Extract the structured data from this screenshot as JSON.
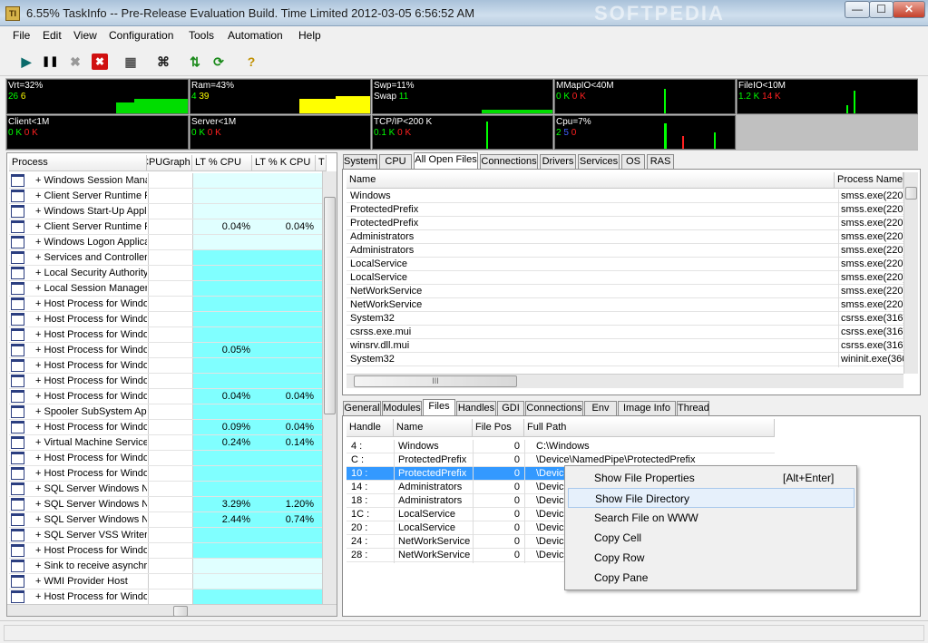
{
  "window": {
    "title": "6.55% TaskInfo -- Pre-Release Evaluation Build. Time Limited   2012-03-05 6:56:52 AM",
    "watermark": "SOFTPEDIA",
    "controls": {
      "minimize": "—",
      "maximize": "☐",
      "close": "✕"
    }
  },
  "menu": [
    "File",
    "Edit",
    "View",
    "Configuration",
    "Tools",
    "Automation",
    "Help"
  ],
  "toolbar": {
    "icons": [
      "play-icon",
      "pause-icon",
      "stop-icon",
      "kill-icon",
      "properties-icon",
      "binoculars-icon",
      "refresh-swap-icon",
      "refresh-icon",
      "help-icon"
    ],
    "glyphs": [
      "▶",
      "❚❚",
      "✖",
      "✖",
      "▦",
      "⌘",
      "⇅",
      "⟳",
      "?"
    ]
  },
  "graphs": {
    "vrt": {
      "label": "Vrt=32%",
      "v1": "26",
      "v2": "6"
    },
    "ram": {
      "label": "Ram=43%",
      "v1": "4",
      "v2": "39"
    },
    "swp": {
      "label": "Swp=11%",
      "v1": "Swap",
      "v2": "11"
    },
    "mmapio": {
      "label": "MMapIO<40M",
      "v1": "0 K",
      "v2": "0 K"
    },
    "fileio": {
      "label": "FileIO<10M",
      "v1": "1.2 K",
      "v2": "14 K"
    },
    "client": {
      "label": "Client<1M",
      "v1": "0 K",
      "v2": "0 K"
    },
    "server": {
      "label": "Server<1M",
      "v1": "0 K",
      "v2": "0 K"
    },
    "tcpip": {
      "label": "TCP/IP<200 K",
      "v1": "0.1 K",
      "v2": "0 K"
    },
    "cpu": {
      "label": "Cpu=7%",
      "v1": "2",
      "v2": "5",
      "v3": "0"
    }
  },
  "process_table": {
    "headers": [
      "Process",
      "CPUGraph",
      "LT % CPU",
      "LT % K CPU",
      "T"
    ],
    "rows": [
      {
        "name": "+ Windows Session Mana",
        "cpu": "",
        "kcpu": "",
        "hl": false
      },
      {
        "name": "+ Client Server Runtime P",
        "cpu": "",
        "kcpu": "",
        "hl": false
      },
      {
        "name": "+ Windows Start-Up Appli",
        "cpu": "",
        "kcpu": "",
        "hl": false
      },
      {
        "name": "+ Client Server Runtime P",
        "cpu": "0.04%",
        "kcpu": "0.04%",
        "hl": false
      },
      {
        "name": "+ Windows Logon Applica",
        "cpu": "",
        "kcpu": "",
        "hl": false
      },
      {
        "name": "+ Services and Controller",
        "cpu": "",
        "kcpu": "",
        "hl": true
      },
      {
        "name": "+ Local Security Authority",
        "cpu": "",
        "kcpu": "",
        "hl": true
      },
      {
        "name": "+ Local Session Manager",
        "cpu": "",
        "kcpu": "",
        "hl": true
      },
      {
        "name": "+ Host Process for Windo",
        "cpu": "",
        "kcpu": "",
        "hl": true
      },
      {
        "name": "+ Host Process for Windo",
        "cpu": "",
        "kcpu": "",
        "hl": true
      },
      {
        "name": "+ Host Process for Windo",
        "cpu": "",
        "kcpu": "",
        "hl": true
      },
      {
        "name": "+ Host Process for Windo",
        "cpu": "0.05%",
        "kcpu": "",
        "hl": true
      },
      {
        "name": "+ Host Process for Windo",
        "cpu": "",
        "kcpu": "",
        "hl": true
      },
      {
        "name": "+ Host Process for Windo",
        "cpu": "",
        "kcpu": "",
        "hl": true
      },
      {
        "name": "+ Host Process for Windo",
        "cpu": "0.04%",
        "kcpu": "0.04%",
        "hl": true
      },
      {
        "name": "+ Spooler SubSystem App",
        "cpu": "",
        "kcpu": "",
        "hl": true
      },
      {
        "name": "+ Host Process for Windo",
        "cpu": "0.09%",
        "kcpu": "0.04%",
        "hl": true
      },
      {
        "name": "+ Virtual Machine Service",
        "cpu": "0.24%",
        "kcpu": "0.14%",
        "hl": true
      },
      {
        "name": "+ Host Process for Windo",
        "cpu": "",
        "kcpu": "",
        "hl": true
      },
      {
        "name": "+ Host Process for Windo",
        "cpu": "",
        "kcpu": "",
        "hl": true
      },
      {
        "name": "+ SQL Server Windows N",
        "cpu": "",
        "kcpu": "",
        "hl": true
      },
      {
        "name": "+ SQL Server Windows N",
        "cpu": "3.29%",
        "kcpu": "1.20%",
        "hl": true
      },
      {
        "name": "+ SQL Server Windows N",
        "cpu": "2.44%",
        "kcpu": "0.74%",
        "hl": true
      },
      {
        "name": "+ SQL Server VSS Writer",
        "cpu": "",
        "kcpu": "",
        "hl": true
      },
      {
        "name": "+ Host Process for Windo",
        "cpu": "",
        "kcpu": "",
        "hl": true
      },
      {
        "name": "+ Sink to receive asynchr",
        "cpu": "",
        "kcpu": "",
        "hl": false
      },
      {
        "name": "+ WMI Provider Host",
        "cpu": "",
        "kcpu": "",
        "hl": false
      },
      {
        "name": "+ Host Process for Windo",
        "cpu": "",
        "kcpu": "",
        "hl": true
      }
    ]
  },
  "top_tabs": [
    "System",
    "CPU",
    "All Open Files",
    "Connections",
    "Drivers",
    "Services",
    "OS",
    "RAS"
  ],
  "top_tabs_active": 2,
  "files_table": {
    "headers": [
      "Name",
      "Process Name"
    ],
    "rows": [
      [
        "Windows",
        "smss.exe(220)"
      ],
      [
        "ProtectedPrefix",
        "smss.exe(220)"
      ],
      [
        "ProtectedPrefix",
        "smss.exe(220)"
      ],
      [
        "Administrators",
        "smss.exe(220)"
      ],
      [
        "Administrators",
        "smss.exe(220)"
      ],
      [
        "LocalService",
        "smss.exe(220)"
      ],
      [
        "LocalService",
        "smss.exe(220)"
      ],
      [
        "NetWorkService",
        "smss.exe(220)"
      ],
      [
        "NetWorkService",
        "smss.exe(220)"
      ],
      [
        "System32",
        "csrss.exe(316)"
      ],
      [
        "csrss.exe.mui",
        "csrss.exe(316)"
      ],
      [
        "winsrv.dll.mui",
        "csrss.exe(316)"
      ],
      [
        "System32",
        "wininit.exe(360"
      ]
    ],
    "hscroll": "III"
  },
  "bottom_tabs": [
    "General",
    "Modules",
    "Files",
    "Handles",
    "GDI",
    "Connections",
    "Env",
    "Image Info",
    "Thread"
  ],
  "bottom_tabs_active": 2,
  "handles_table": {
    "headers": [
      "Handle",
      "Name",
      "File Pos",
      "Full Path"
    ],
    "rows": [
      [
        "4 :",
        "Windows",
        "0",
        "C:\\Windows"
      ],
      [
        "C :",
        "ProtectedPrefix",
        "0",
        "\\Device\\NamedPipe\\ProtectedPrefix"
      ],
      [
        "10 :",
        "ProtectedPrefix",
        "0",
        "\\Device"
      ],
      [
        "14 :",
        "Administrators",
        "0",
        "\\Device"
      ],
      [
        "18 :",
        "Administrators",
        "0",
        "\\Device"
      ],
      [
        "1C :",
        "LocalService",
        "0",
        "\\Device"
      ],
      [
        "20 :",
        "LocalService",
        "0",
        "\\Device"
      ],
      [
        "24 :",
        "NetWorkService",
        "0",
        "\\Device"
      ],
      [
        "28 :",
        "NetWorkService",
        "0",
        "\\Device"
      ]
    ],
    "selected": 2
  },
  "context_menu": {
    "items": [
      {
        "label": "Show File Properties",
        "shortcut": "[Alt+Enter]"
      },
      {
        "label": "Show File Directory",
        "shortcut": ""
      },
      {
        "label": "Search File on WWW",
        "shortcut": ""
      },
      {
        "label": "Copy Cell",
        "shortcut": ""
      },
      {
        "label": "Copy Row",
        "shortcut": ""
      },
      {
        "label": "Copy Pane",
        "shortcut": ""
      }
    ],
    "highlighted": 1
  },
  "colors": {
    "highlight_row": "#80ffff",
    "light_row": "#e0ffff",
    "selection": "#3399ff",
    "graph_bg": "#000000"
  }
}
